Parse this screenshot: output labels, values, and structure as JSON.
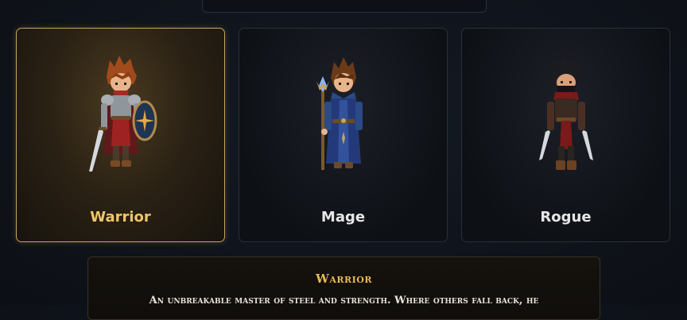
{
  "classes": [
    {
      "name": "Warrior",
      "selected": true,
      "sprite": "warrior-sprite"
    },
    {
      "name": "Mage",
      "selected": false,
      "sprite": "mage-sprite"
    },
    {
      "name": "Rogue",
      "selected": false,
      "sprite": "rogue-sprite"
    }
  ],
  "details": {
    "title": "Warrior",
    "description": "An unbreakable master of steel and strength. Where others fall back, he"
  },
  "colors": {
    "accent_gold": "#f0c469",
    "selected_border": "#c9a45c"
  }
}
